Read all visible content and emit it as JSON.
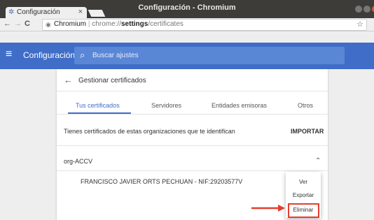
{
  "window": {
    "title": "Configuración - Chromium"
  },
  "tab": {
    "label": "Configuración",
    "close": "×"
  },
  "toolbar": {
    "back": "←",
    "forward": "→",
    "reload": "C",
    "url_host": "Chromium",
    "url_sep": "|",
    "url_scheme": "chrome://",
    "url_bold": "settings",
    "url_path": "/certificates",
    "star": "☆"
  },
  "appbar": {
    "menu_icon": "≡",
    "title": "Configuración",
    "search_placeholder": "Buscar ajustes"
  },
  "card": {
    "back_icon": "←",
    "heading": "Gestionar certificados",
    "tabs": [
      {
        "label": "Tus certificados",
        "selected": true
      },
      {
        "label": "Servidores",
        "selected": false
      },
      {
        "label": "Entidades emisoras",
        "selected": false
      },
      {
        "label": "Otros",
        "selected": false
      }
    ],
    "info_text": "Tienes certificados de estas organizaciones que te identifican",
    "import_label": "IMPORTAR",
    "org_name": "org-ACCV",
    "chevron": "⌃",
    "cert_name": "FRANCISCO JAVIER ORTS PECHUAN - NIF:29203577V"
  },
  "context_menu": {
    "items": [
      "Ver",
      "Exportar",
      "Eliminar"
    ]
  },
  "colors": {
    "accent": "#3f6dc7",
    "highlight": "#e53e2d"
  }
}
